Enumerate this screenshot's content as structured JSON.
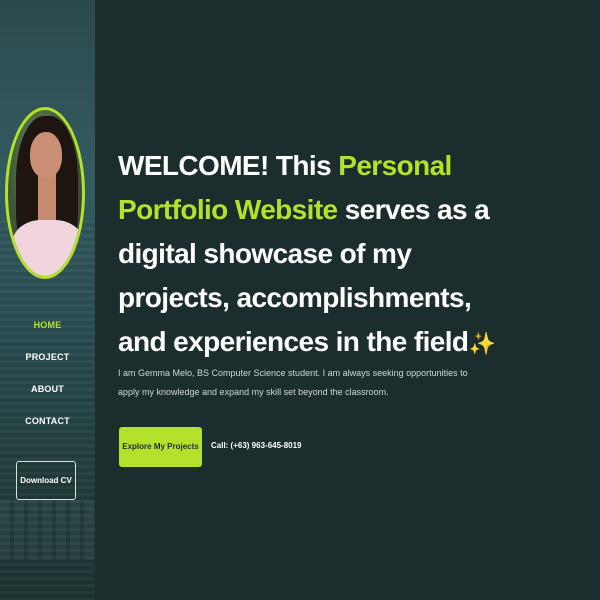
{
  "sidebar": {
    "nav_items": [
      {
        "label": "HOME",
        "active": true
      },
      {
        "label": "PROJECT",
        "active": false
      },
      {
        "label": "ABOUT",
        "active": false
      },
      {
        "label": "CONTACT",
        "active": false
      }
    ],
    "download_cv_label": "Download CV"
  },
  "hero": {
    "headline_part1": "WELCOME! This ",
    "headline_accent": "Personal Portfolio Website",
    "headline_part2": " serves as a digital showcase of my projects, accomplishments, and experiences in the field",
    "sparkle": "✨",
    "intro": "I am Gemma Melo, BS Computer Science student. I am always seeking opportunities to apply my knowledge and expand my skill set beyond the classroom.",
    "explore_button_label": "Explore My Projects",
    "call_text": "Call: (+63) 963-645-8019"
  },
  "colors": {
    "accent": "#b6e12a",
    "background": "#1b2e2d",
    "text": "#ffffff"
  },
  "icons": {
    "sparkle": "sparkles-emoji"
  }
}
